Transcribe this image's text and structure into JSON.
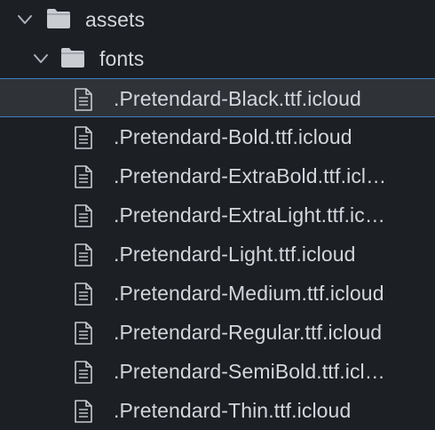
{
  "explorer": {
    "folders": {
      "assets": {
        "label": "assets",
        "icon": "folder-icon",
        "state": "expanded"
      },
      "fonts": {
        "label": "fonts",
        "icon": "folder-icon",
        "state": "expanded"
      }
    },
    "files": [
      {
        "label": ".Pretendard-Black.ttf.icloud",
        "icon": "file-icon",
        "selected": true
      },
      {
        "label": ".Pretendard-Bold.ttf.icloud",
        "icon": "file-icon"
      },
      {
        "label": ".Pretendard-ExtraBold.ttf.icl…",
        "icon": "file-icon"
      },
      {
        "label": ".Pretendard-ExtraLight.ttf.ic…",
        "icon": "file-icon"
      },
      {
        "label": ".Pretendard-Light.ttf.icloud",
        "icon": "file-icon"
      },
      {
        "label": ".Pretendard-Medium.ttf.icloud",
        "icon": "file-icon"
      },
      {
        "label": ".Pretendard-Regular.ttf.icloud",
        "icon": "file-icon"
      },
      {
        "label": ".Pretendard-SemiBold.ttf.icl…",
        "icon": "file-icon"
      },
      {
        "label": ".Pretendard-Thin.ttf.icloud",
        "icon": "file-icon"
      }
    ]
  },
  "colors": {
    "background": "#1c1f24",
    "selected_row": "#2f3338",
    "selection_border": "#3f7cc4",
    "text": "#d3d6db",
    "icon": "#c9ccd1"
  }
}
